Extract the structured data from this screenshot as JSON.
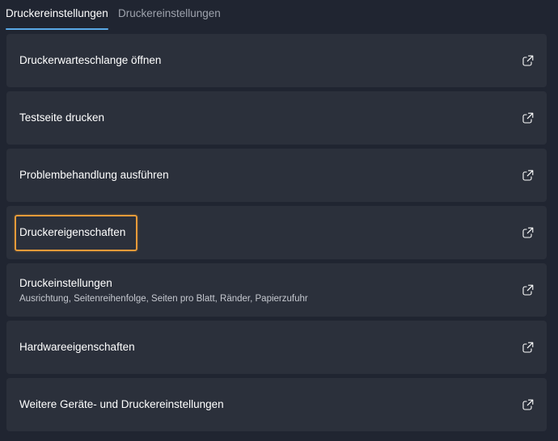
{
  "tabs": [
    {
      "label": "Druckereinstellungen",
      "active": true
    },
    {
      "label": "Druckereinstellungen",
      "active": false
    }
  ],
  "items": [
    {
      "title": "Druckerwarteschlange öffnen",
      "icon": "open-external-icon"
    },
    {
      "title": "Testseite drucken",
      "icon": "open-external-icon"
    },
    {
      "title": "Problembehandlung ausführen",
      "icon": "open-external-icon"
    },
    {
      "title": "Druckereigenschaften",
      "icon": "open-external-icon",
      "focused": true
    },
    {
      "title": "Druckeinstellungen",
      "subtitle": "Ausrichtung, Seitenreihenfolge, Seiten pro Blatt, Ränder, Papierzufuhr",
      "icon": "open-external-icon"
    },
    {
      "title": "Hardwareeigenschaften",
      "icon": "open-external-icon"
    },
    {
      "title": "Weitere Geräte- und Druckereinstellungen",
      "icon": "open-external-icon"
    }
  ],
  "colors": {
    "background": "#202531",
    "card": "#2b303b",
    "accent": "#5aa9e6",
    "focus": "#e79b39",
    "text": "#ffffff",
    "muted_text": "#9ea3ad"
  }
}
